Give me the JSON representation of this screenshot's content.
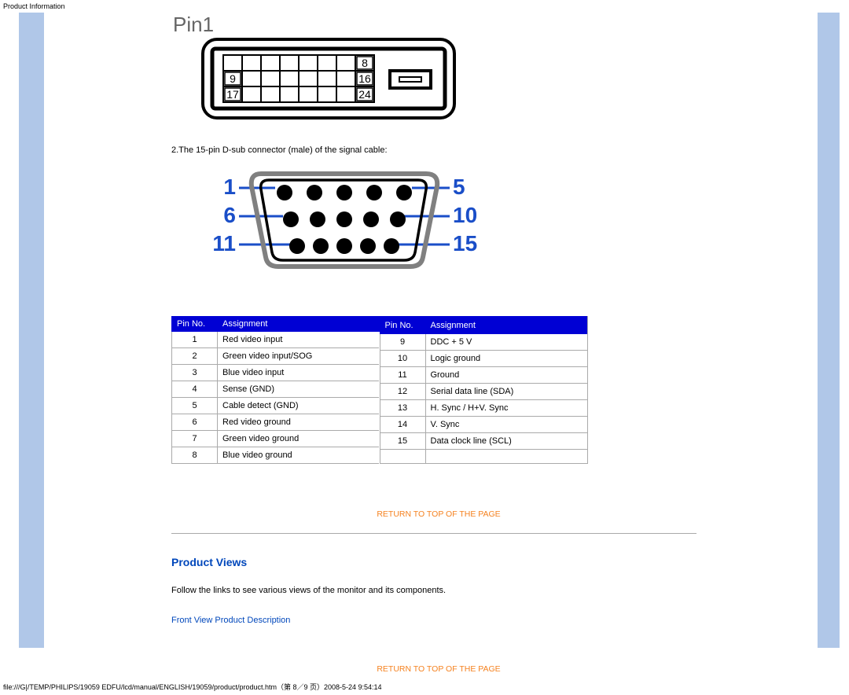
{
  "header_label": "Product Information",
  "dvi": {
    "pin1_label": "Pin1",
    "numbers": [
      "8",
      "9",
      "16",
      "17",
      "24"
    ]
  },
  "dsub": {
    "desc": "2.The 15-pin D-sub connector (male) of the signal cable:",
    "left_labels": [
      "1",
      "6",
      "11"
    ],
    "right_labels": [
      "5",
      "10",
      "15"
    ]
  },
  "pin_table": {
    "headers": {
      "pin": "Pin No.",
      "assign": "Assignment"
    },
    "left": [
      {
        "pin": "1",
        "assign": "Red video input"
      },
      {
        "pin": "2",
        "assign": "Green video input/SOG"
      },
      {
        "pin": "3",
        "assign": "Blue video input"
      },
      {
        "pin": "4",
        "assign": "Sense (GND)"
      },
      {
        "pin": "5",
        "assign": "Cable detect (GND)"
      },
      {
        "pin": "6",
        "assign": "Red video ground"
      },
      {
        "pin": "7",
        "assign": "Green video ground"
      },
      {
        "pin": "8",
        "assign": "Blue video ground"
      }
    ],
    "right": [
      {
        "pin": "9",
        "assign": "DDC + 5 V"
      },
      {
        "pin": "10",
        "assign": "Logic ground"
      },
      {
        "pin": "11",
        "assign": "Ground"
      },
      {
        "pin": "12",
        "assign": "Serial data line (SDA)"
      },
      {
        "pin": "13",
        "assign": "H. Sync / H+V. Sync"
      },
      {
        "pin": "14",
        "assign": "V. Sync"
      },
      {
        "pin": "15",
        "assign": "Data clock line (SCL)"
      }
    ]
  },
  "return_link": "RETURN TO TOP OF THE PAGE",
  "product_views": {
    "heading": "Product Views",
    "desc": "Follow the links to see various views of the monitor and its components.",
    "link": "Front View Product Description"
  },
  "footer_path": "file:///G|/TEMP/PHILIPS/19059 EDFU/lcd/manual/ENGLISH/19059/product/product.htm（第 8／9 页）2008-5-24 9:54:14"
}
